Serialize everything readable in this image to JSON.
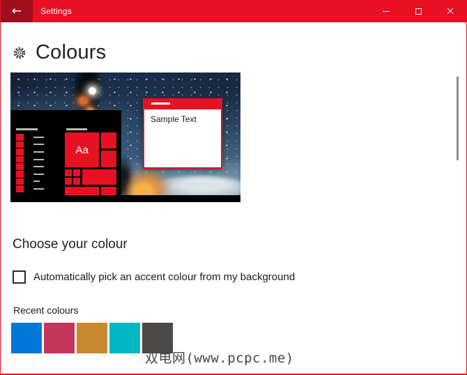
{
  "window": {
    "title": "Settings",
    "accent_color": "#e81123",
    "back_button_color": "#9f0f1b"
  },
  "icons": {
    "back": "←",
    "close": "×",
    "gear": "gear-outline"
  },
  "page": {
    "title": "Colours"
  },
  "preview": {
    "start_tile_label": "Aa",
    "sample_window_text": "Sample Text"
  },
  "choose": {
    "heading": "Choose your colour",
    "checkbox_label": "Automatically pick an accent colour from my background",
    "checkbox_checked": false
  },
  "recent": {
    "heading": "Recent colours",
    "colors": [
      "#0078d7",
      "#c4355b",
      "#c9872e",
      "#00b7c3",
      "#4c4a48"
    ]
  },
  "watermark": {
    "text": "双电网(www.pcpc.me)"
  }
}
